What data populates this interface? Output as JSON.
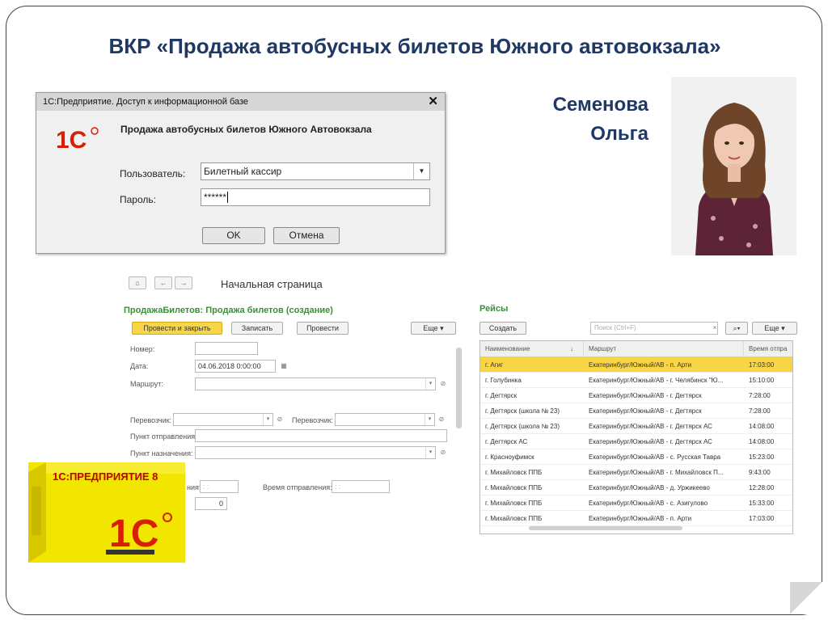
{
  "slide": {
    "title": "ВКР «Продажа автобусных билетов Южного автовокзала»",
    "author_first": "Семенова",
    "author_second": "Ольга"
  },
  "login": {
    "window_title": "1С:Предприятие. Доступ к информационной базе",
    "app_name": "Продажа автобусных билетов Южного Автовокзала",
    "user_label": "Пользователь:",
    "user_value": "Билетный кассир",
    "password_label": "Пароль:",
    "password_value": "******",
    "ok_label": "OK",
    "cancel_label": "Отмена",
    "logo_text": "1С"
  },
  "form": {
    "page_title": "Начальная страница",
    "form_title": "ПродажаБилетов: Продажа билетов (создание)",
    "btn_post_close": "Провести и закрыть",
    "btn_save": "Записать",
    "btn_post": "Провести",
    "btn_more": "Еще",
    "lbl_number": "Номер:",
    "lbl_date": "Дата:",
    "date_value": "04.06.2018  0:00:00",
    "lbl_route": "Маршрут:",
    "lbl_carrier": "Перевозчик:",
    "lbl_carrier2": "Перевозчик:",
    "lbl_from": "Пункт отправления:",
    "lbl_to": "Пункт назначения:",
    "lbl_partial": "ния:",
    "lbl_departure": "Время отправления:",
    "time_placeholder": ": :",
    "qty_value": "0"
  },
  "routes": {
    "title": "Рейсы",
    "btn_create": "Создать",
    "search_placeholder": "Поиск (Ctrl+F)",
    "btn_more": "Еще",
    "headers": [
      "Наименование",
      "Маршрут",
      "Время отпра"
    ],
    "sort_mark": "↓",
    "rows": [
      {
        "name": "г. Агиг",
        "route": "Екатеринбург/Южный/АВ - п. Арти",
        "time": "17:03:00"
      },
      {
        "name": "г. Голубинка",
        "route": "Екатеринбург/Южный/АВ - г. Челябинск \"Ю...",
        "time": "15:10:00"
      },
      {
        "name": "г. Дегтярск",
        "route": "Екатеринбург/Южный/АВ - г. Дегтярск",
        "time": "7:28:00"
      },
      {
        "name": "г. Дегтярск (школа № 23)",
        "route": "Екатеринбург/Южный/АВ - г. Дегтярск",
        "time": "7:28:00"
      },
      {
        "name": "г. Дегтярск (школа № 23)",
        "route": "Екатеринбург/Южный/АВ - г. Дегтярск АС",
        "time": "14:08:00"
      },
      {
        "name": "г. Дегтярск АС",
        "route": "Екатеринбург/Южный/АВ - г. Дегтярск АС",
        "time": "14:08:00"
      },
      {
        "name": "г. Красноуфимск",
        "route": "Екатеринбург/Южный/АВ - с. Русская Тавра",
        "time": "15:23:00"
      },
      {
        "name": "г. Михайловск ППБ",
        "route": "Екатеринбург/Южный/АВ - г. Михайловск П...",
        "time": "9:43:00"
      },
      {
        "name": "г. Михайловск ППБ",
        "route": "Екатеринбург/Южный/АВ - д. Уржикеево",
        "time": "12:28:00"
      },
      {
        "name": "г. Михайловск ППБ",
        "route": "Екатеринбург/Южный/АВ - с. Азигулово",
        "time": "15:33:00"
      },
      {
        "name": "г. Михайловск ППБ",
        "route": "Екатеринбург/Южный/АВ - п. Арти",
        "time": "17:03:00"
      }
    ]
  },
  "box": {
    "title": "1С:ПРЕДПРИЯТИЕ 8",
    "logo_text": "1С"
  },
  "colors": {
    "title": "#1f3864",
    "accent_yellow": "#f8d545",
    "form_green": "#3a8e3a",
    "logo_red": "#d81e05"
  }
}
